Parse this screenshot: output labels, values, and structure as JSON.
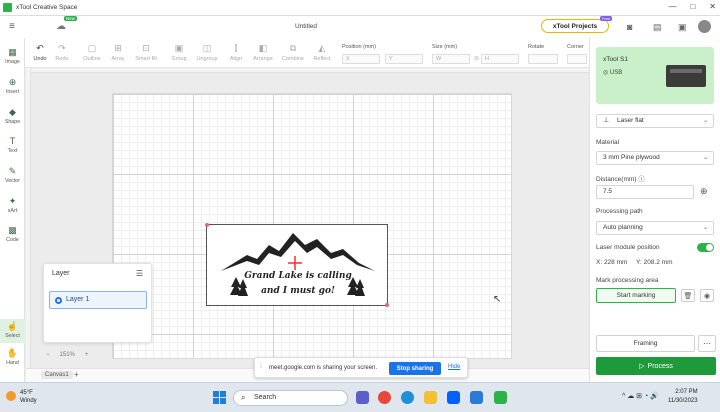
{
  "window": {
    "title": "xTool Creative Space",
    "controls": [
      "—",
      "□",
      "✕"
    ]
  },
  "header": {
    "doc_title": "Untitled",
    "new_badge": "New",
    "projects_label": "xTool Projects",
    "free_badge": "Free"
  },
  "toolbar": {
    "tools": [
      {
        "label": "Undo",
        "icon": "undo-icon",
        "glyph": "↶"
      },
      {
        "label": "Redo",
        "icon": "redo-icon",
        "glyph": "↷"
      },
      {
        "label": "Outline",
        "icon": "outline-icon",
        "glyph": "▢"
      },
      {
        "label": "Array",
        "icon": "array-icon",
        "glyph": "⊞"
      },
      {
        "label": "Smart fill",
        "icon": "smart-fill-icon",
        "glyph": "⊡"
      },
      {
        "label": "Group",
        "icon": "group-icon",
        "glyph": "▣"
      },
      {
        "label": "Ungroup",
        "icon": "ungroup-icon",
        "glyph": "◫"
      },
      {
        "label": "Align",
        "icon": "align-icon",
        "glyph": "⫿"
      },
      {
        "label": "Arrange",
        "icon": "arrange-icon",
        "glyph": "◧"
      },
      {
        "label": "Combine",
        "icon": "combine-icon",
        "glyph": "⧉"
      },
      {
        "label": "Reflect",
        "icon": "reflect-icon",
        "glyph": "◭"
      }
    ],
    "position_label": "Position (mm)",
    "size_label": "Size (mm)",
    "rotate_label": "Rotate",
    "corner_label": "Corner",
    "x_placeholder": "X",
    "y_placeholder": "Y",
    "w_placeholder": "W",
    "h_placeholder": "H"
  },
  "sidebar": {
    "items": [
      {
        "label": "Image",
        "icon": "image-icon",
        "glyph": "▦"
      },
      {
        "label": "Insert",
        "icon": "insert-icon",
        "glyph": "⊕"
      },
      {
        "label": "Shape",
        "icon": "shape-icon",
        "glyph": "◆"
      },
      {
        "label": "Text",
        "icon": "text-icon",
        "glyph": "T"
      },
      {
        "label": "Vector",
        "icon": "vector-icon",
        "glyph": "✎"
      },
      {
        "label": "xArt",
        "icon": "xart-icon",
        "glyph": "✦"
      },
      {
        "label": "Code",
        "icon": "code-icon",
        "glyph": "▩"
      },
      {
        "label": "Select",
        "icon": "select-icon",
        "glyph": "☝"
      },
      {
        "label": "Hand",
        "icon": "hand-icon",
        "glyph": "✋"
      }
    ]
  },
  "canvas": {
    "design_line1": "Grand Lake is calling",
    "design_line2": "and I must go!",
    "zoom": "151%",
    "zoom_minus": "−",
    "zoom_plus": "+",
    "tab_name": "Canvas1",
    "add_tab": "+"
  },
  "layer_panel": {
    "title": "Layer",
    "layers": [
      "Layer 1"
    ]
  },
  "share_banner": {
    "text": "meet.google.com is sharing your screen.",
    "stop_label": "Stop sharing",
    "hide_label": "Hide"
  },
  "right_panel": {
    "device_name": "xTool S1",
    "connection": "USB",
    "mode": "Laser flat",
    "material_label": "Material",
    "material_value": "3 mm Pine plywood",
    "distance_label": "Distance(mm)",
    "distance_value": "7.5",
    "processing_path_label": "Processing path",
    "processing_path_value": "Auto planning",
    "laser_position_label": "Laser module position",
    "laser_position_enabled": true,
    "laser_x": "X: 228 mm",
    "laser_y": "Y: 208.2 mm",
    "mark_area_label": "Mark processing area",
    "start_marking_label": "Start marking",
    "framing_label": "Framing",
    "process_label": "Process",
    "accent_color": "#2db24a"
  },
  "taskbar": {
    "temperature": "45°F",
    "weather": "Windy",
    "search_placeholder": "Search",
    "time": "2:07 PM",
    "date": "11/30/2023"
  }
}
